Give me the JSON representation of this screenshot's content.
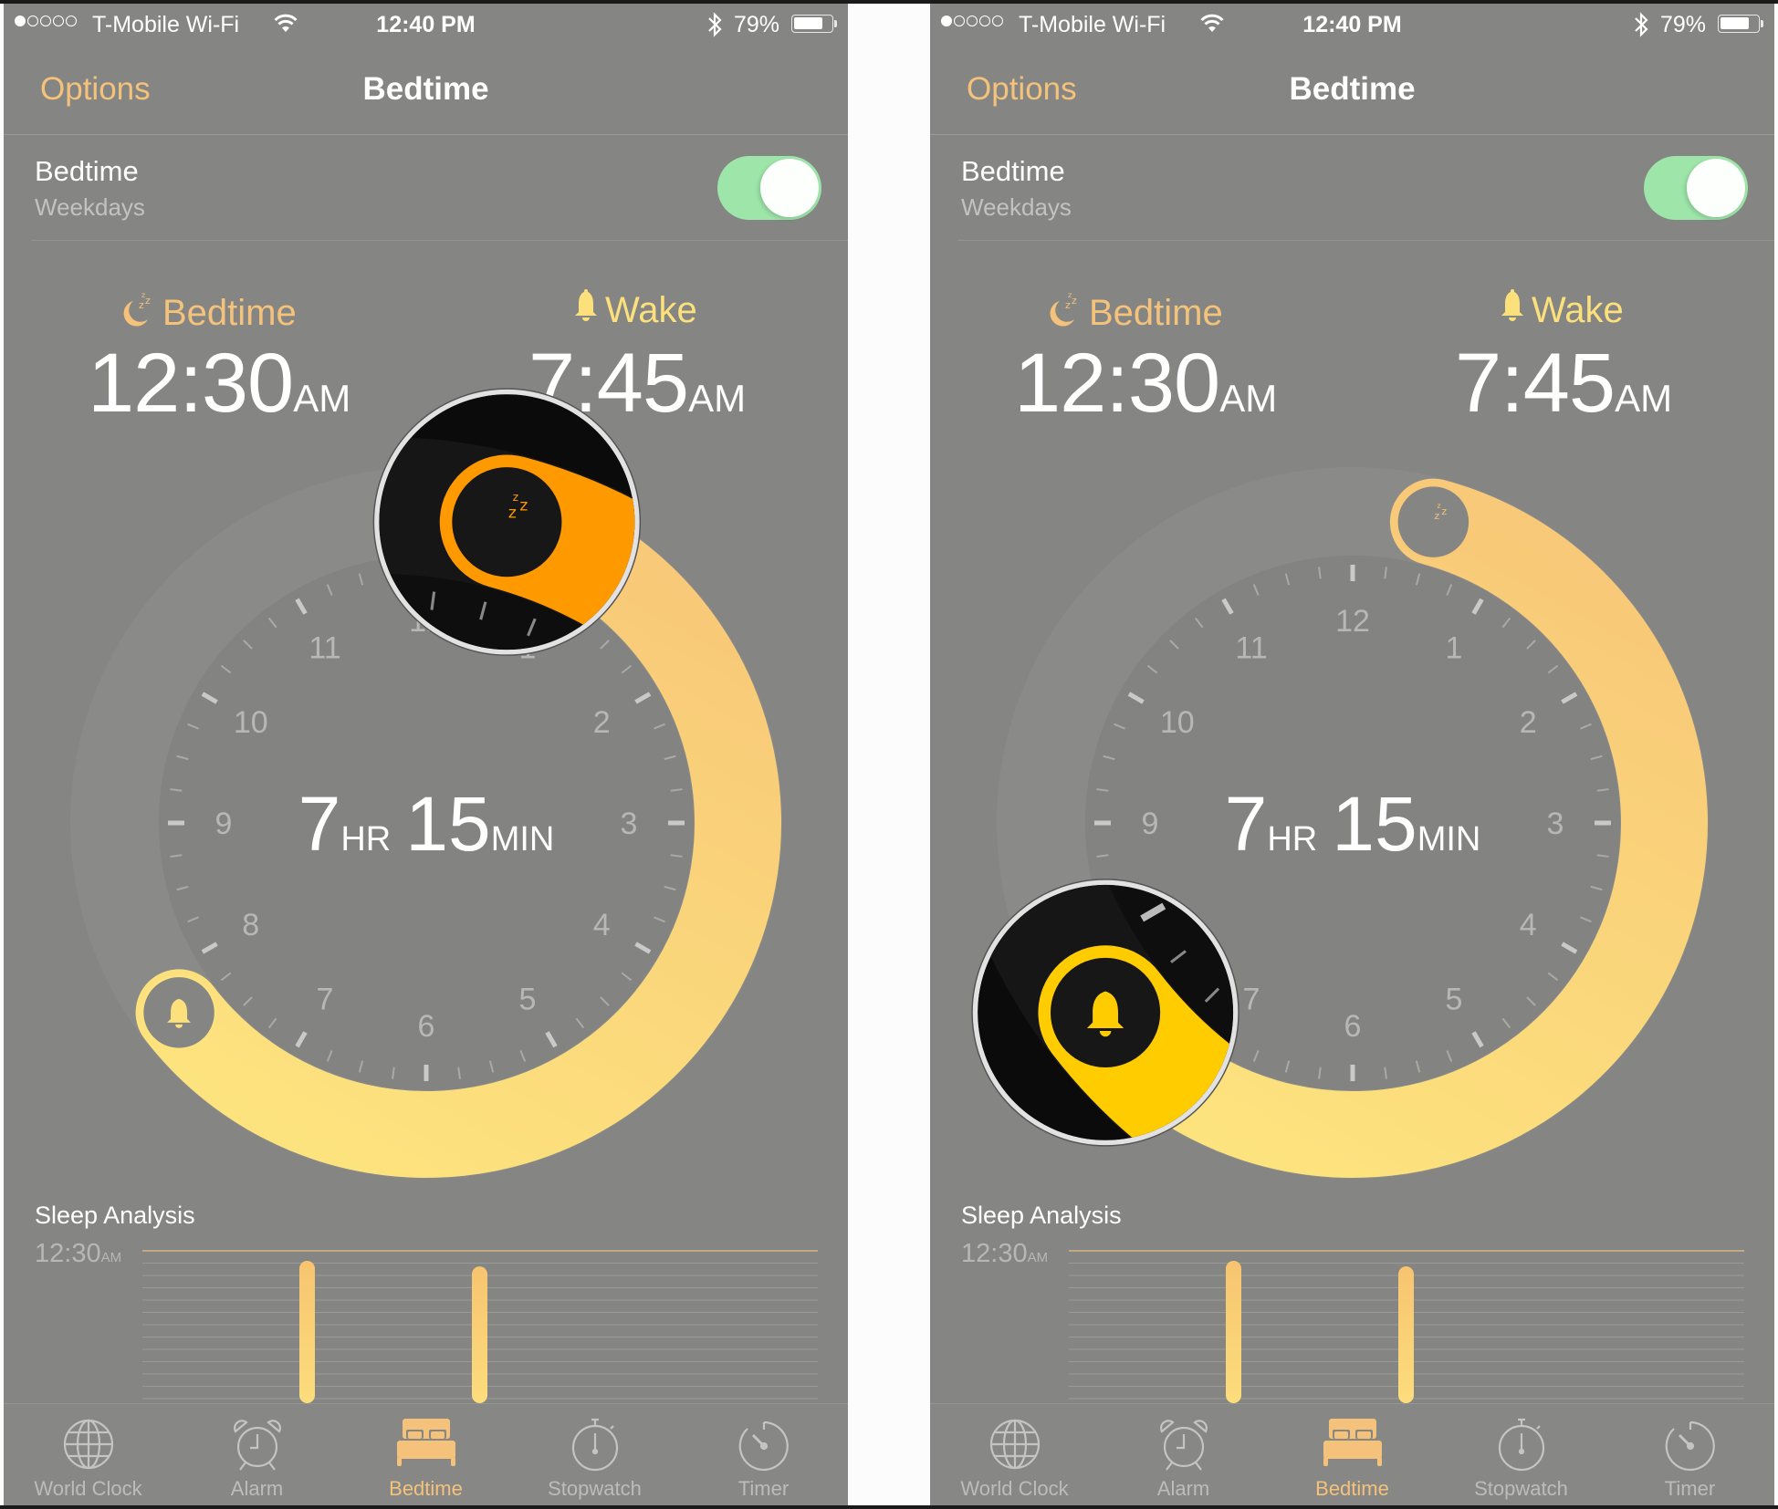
{
  "colors": {
    "background": "#858683",
    "accent": "#f4c27b",
    "wake_accent": "#fbe07c",
    "toggle_on": "#9de5a9",
    "arc_start": "#f8c978",
    "arc_end": "#fde37e",
    "magnifier_bedtime_arc": "#ff9900",
    "magnifier_wake_arc": "#ffcc00"
  },
  "status_bar": {
    "signal_bars_filled": 1,
    "signal_bars_total": 5,
    "carrier": "T-Mobile Wi-Fi",
    "time": "12:40 PM",
    "battery_percent_label": "79%",
    "battery_level": 0.79
  },
  "nav": {
    "left_button": "Options",
    "title": "Bedtime"
  },
  "schedule_row": {
    "title": "Bedtime",
    "subtitle": "Weekdays",
    "toggle_on": true
  },
  "bedtime": {
    "label": "Bedtime",
    "time": "12:30",
    "ampm": "AM",
    "hour_value": 0.5
  },
  "wake": {
    "label": "Wake",
    "time": "7:45",
    "ampm": "AM",
    "hour_value": 7.75
  },
  "duration": {
    "hours": "7",
    "hours_unit": "HR",
    "minutes": "15",
    "minutes_unit": "MIN"
  },
  "clock_face": {
    "hour_labels": [
      "12",
      "1",
      "2",
      "3",
      "4",
      "5",
      "6",
      "7",
      "8",
      "9",
      "10",
      "11"
    ]
  },
  "sleep_analysis": {
    "title": "Sleep Analysis",
    "reference_time": "12:30",
    "reference_ampm": "AM",
    "bars": [
      {
        "label": "night-1",
        "relative_height": 1.0
      },
      {
        "label": "night-2",
        "relative_height": 0.96
      }
    ]
  },
  "tabs": [
    {
      "label": "World Clock",
      "icon": "globe-icon",
      "active": false
    },
    {
      "label": "Alarm",
      "icon": "alarm-clock-icon",
      "active": false
    },
    {
      "label": "Bedtime",
      "icon": "bed-icon",
      "active": true
    },
    {
      "label": "Stopwatch",
      "icon": "stopwatch-icon",
      "active": false
    },
    {
      "label": "Timer",
      "icon": "timer-icon",
      "active": false
    }
  ],
  "panels": [
    {
      "magnified_handle": "bedtime"
    },
    {
      "magnified_handle": "wake"
    }
  ]
}
